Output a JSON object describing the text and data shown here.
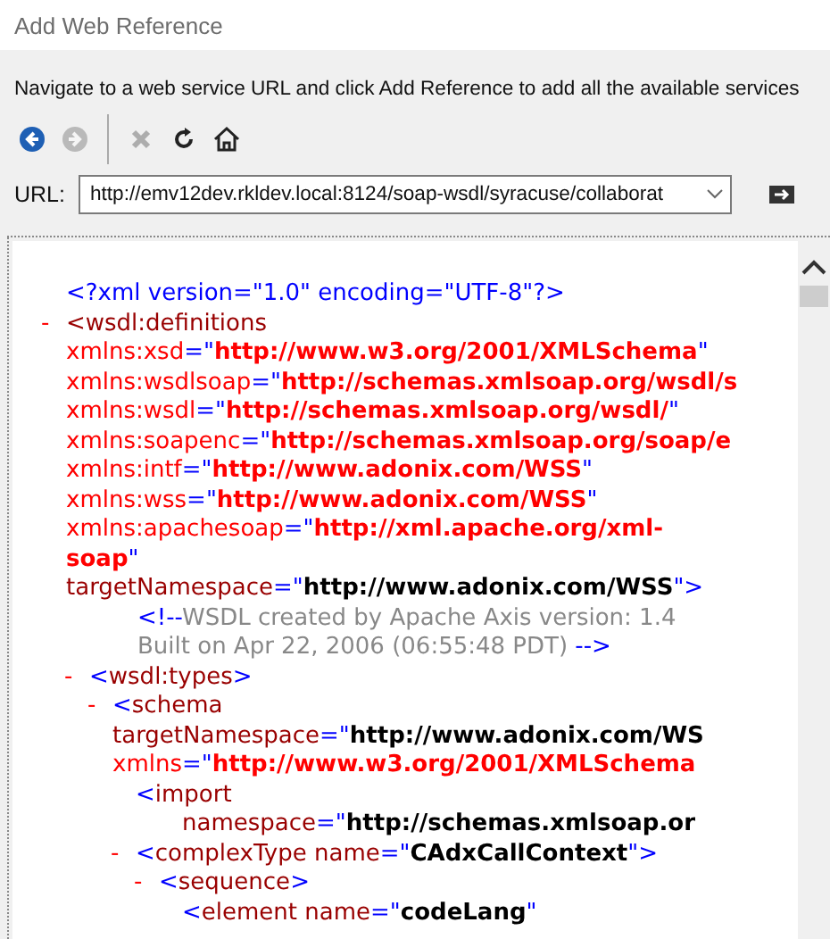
{
  "window": {
    "title": "Add Web Reference"
  },
  "instructions": "Navigate to a web service URL and click Add Reference to add all the available services",
  "toolbar": [
    {
      "kind": "back",
      "disabled": false
    },
    {
      "kind": "forward",
      "disabled": true
    },
    {
      "kind": "separator"
    },
    {
      "kind": "stop",
      "disabled": true
    },
    {
      "kind": "refresh",
      "disabled": false
    },
    {
      "kind": "home",
      "disabled": false
    }
  ],
  "url": {
    "label": "URL:",
    "value": "http://emv12dev.rkldev.local:8124/soap-wsdl/syracuse/collaborat"
  },
  "document": {
    "nodes": [
      {
        "kind": "element",
        "lines": [
          [
            {
              "kind": "punct",
              "text": "<?xml version=\"1.0\" encoding=\"UTF-8\"?>"
            }
          ]
        ]
      },
      {
        "kind": "element",
        "toggle": "-",
        "lines": [
          [
            {
              "kind": "tag",
              "text": "<wsdl:definitions"
            }
          ],
          [
            {
              "kind": "nsattr",
              "text": "xmlns:xsd"
            },
            {
              "kind": "punct",
              "text": "=\""
            },
            {
              "kind": "nsvalue",
              "text": "http://www.w3.org/2001/XMLSchema"
            },
            {
              "kind": "punct",
              "text": "\""
            }
          ],
          [
            {
              "kind": "nsattr",
              "text": "xmlns:wsdlsoap"
            },
            {
              "kind": "punct",
              "text": "=\""
            },
            {
              "kind": "nsvalue",
              "text": "http://schemas.xmlsoap.org/wsdl/s"
            }
          ],
          [
            {
              "kind": "nsattr",
              "text": "xmlns:wsdl"
            },
            {
              "kind": "punct",
              "text": "=\""
            },
            {
              "kind": "nsvalue",
              "text": "http://schemas.xmlsoap.org/wsdl/"
            },
            {
              "kind": "punct",
              "text": "\""
            }
          ],
          [
            {
              "kind": "nsattr",
              "text": "xmlns:soapenc"
            },
            {
              "kind": "punct",
              "text": "=\""
            },
            {
              "kind": "nsvalue",
              "text": "http://schemas.xmlsoap.org/soap/e"
            }
          ],
          [
            {
              "kind": "nsattr",
              "text": "xmlns:intf"
            },
            {
              "kind": "punct",
              "text": "=\""
            },
            {
              "kind": "nsvalue",
              "text": "http://www.adonix.com/WSS"
            },
            {
              "kind": "punct",
              "text": "\""
            }
          ],
          [
            {
              "kind": "nsattr",
              "text": "xmlns:wss"
            },
            {
              "kind": "punct",
              "text": "=\""
            },
            {
              "kind": "nsvalue",
              "text": "http://www.adonix.com/WSS"
            },
            {
              "kind": "punct",
              "text": "\""
            }
          ],
          [
            {
              "kind": "nsattr",
              "text": "xmlns:apachesoap"
            },
            {
              "kind": "punct",
              "text": "=\""
            },
            {
              "kind": "nsvalue",
              "text": "http://xml.apache.org/xml-"
            }
          ],
          [
            {
              "kind": "nsvalue",
              "text": "soap"
            },
            {
              "kind": "punct",
              "text": "\""
            }
          ],
          [
            {
              "kind": "attr",
              "text": "targetNamespace"
            },
            {
              "kind": "punct",
              "text": "=\""
            },
            {
              "kind": "value",
              "text": "http://www.adonix.com/WSS"
            },
            {
              "kind": "punct",
              "text": "\">"
            }
          ]
        ],
        "children": [
          {
            "kind": "comment",
            "lines": [
              [
                {
                  "kind": "punct",
                  "text": "<!--"
                },
                {
                  "kind": "comment",
                  "text": "WSDL created by Apache Axis version: 1.4"
                }
              ],
              [
                {
                  "kind": "comment",
                  "text": "Built on Apr 22, 2006 (06:55:48 PDT)"
                },
                {
                  "kind": "punct",
                  "text": " -->"
                }
              ]
            ]
          },
          {
            "kind": "element",
            "toggle": "-",
            "lines": [
              [
                {
                  "kind": "punct",
                  "text": "<"
                },
                {
                  "kind": "tag",
                  "text": "wsdl:types"
                },
                {
                  "kind": "punct",
                  "text": ">"
                }
              ]
            ],
            "children": [
              {
                "kind": "element",
                "toggle": "-",
                "lines": [
                  [
                    {
                      "kind": "punct",
                      "text": "<"
                    },
                    {
                      "kind": "tag",
                      "text": "schema"
                    }
                  ],
                  [
                    {
                      "kind": "attr",
                      "text": "targetNamespace"
                    },
                    {
                      "kind": "punct",
                      "text": "=\""
                    },
                    {
                      "kind": "value",
                      "text": "http://www.adonix.com/WS"
                    }
                  ],
                  [
                    {
                      "kind": "nsattr",
                      "text": "xmlns"
                    },
                    {
                      "kind": "punct",
                      "text": "=\""
                    },
                    {
                      "kind": "nsvalue",
                      "text": "http://www.w3.org/2001/XMLSchema"
                    }
                  ]
                ],
                "children": [
                  {
                    "kind": "element",
                    "lines": [
                      [
                        {
                          "kind": "punct",
                          "text": "<"
                        },
                        {
                          "kind": "tag",
                          "text": "import"
                        }
                      ],
                      [
                        {
                          "kind": "attr",
                          "text": "namespace"
                        },
                        {
                          "kind": "punct",
                          "text": "=\""
                        },
                        {
                          "kind": "value",
                          "text": "http://schemas.xmlsoap.or"
                        }
                      ]
                    ]
                  },
                  {
                    "kind": "element",
                    "toggle": "-",
                    "lines": [
                      [
                        {
                          "kind": "punct",
                          "text": "<"
                        },
                        {
                          "kind": "tag",
                          "text": "complexType"
                        },
                        {
                          "kind": "attr",
                          "text": " name"
                        },
                        {
                          "kind": "punct",
                          "text": "=\""
                        },
                        {
                          "kind": "value",
                          "text": "CAdxCallContext"
                        },
                        {
                          "kind": "punct",
                          "text": "\">"
                        }
                      ]
                    ],
                    "children": [
                      {
                        "kind": "element",
                        "toggle": "-",
                        "lines": [
                          [
                            {
                              "kind": "punct",
                              "text": "<"
                            },
                            {
                              "kind": "tag",
                              "text": "sequence"
                            },
                            {
                              "kind": "punct",
                              "text": ">"
                            }
                          ]
                        ],
                        "children": [
                          {
                            "kind": "element",
                            "lines": [
                              [
                                {
                                  "kind": "punct",
                                  "text": "<"
                                },
                                {
                                  "kind": "tag",
                                  "text": "element"
                                },
                                {
                                  "kind": "attr",
                                  "text": " name"
                                },
                                {
                                  "kind": "punct",
                                  "text": "=\""
                                },
                                {
                                  "kind": "value",
                                  "text": "codeLang"
                                },
                                {
                                  "kind": "punct",
                                  "text": "\""
                                }
                              ]
                            ]
                          }
                        ]
                      }
                    ]
                  }
                ]
              }
            ]
          }
        ]
      }
    ]
  }
}
